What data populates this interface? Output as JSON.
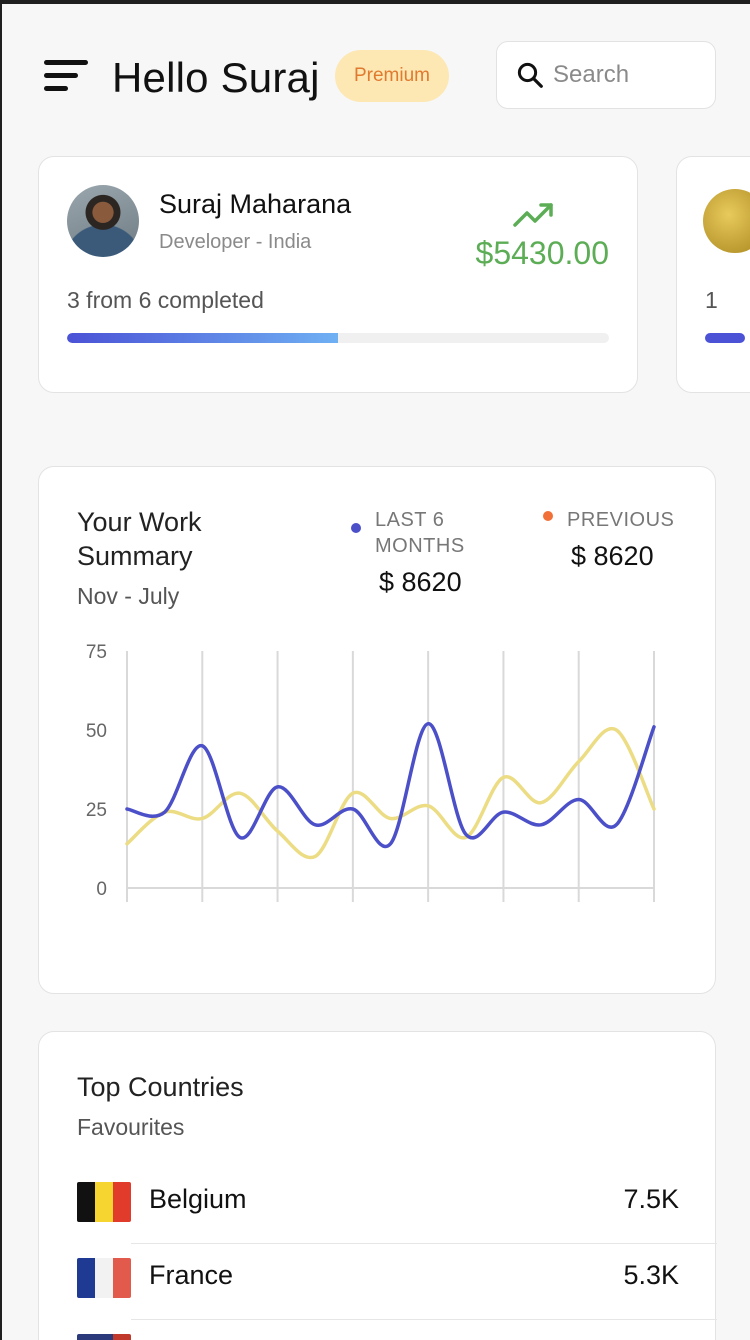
{
  "header": {
    "greeting": "Hello Suraj",
    "badge": "Premium",
    "search_placeholder": "Search"
  },
  "profile": {
    "name": "Suraj Maharana",
    "role": "Developer - India",
    "earnings": "$5430.00",
    "progress_text": "3 from 6 completed",
    "progress_fraction": 0.5,
    "earnings_color": "#5cad55"
  },
  "profile_peek": {
    "progress_text": "1"
  },
  "summary": {
    "title": "Your Work Summary",
    "range": "Nov - July",
    "legend": [
      {
        "label": "LAST 6 MONTHS",
        "value": "$ 8620",
        "color": "#4b4fc8"
      },
      {
        "label": "PREVIOUS",
        "value": "$ 8620",
        "color": "#f07038"
      }
    ]
  },
  "chart_data": {
    "type": "line",
    "y_ticks": [
      "75",
      "50",
      "25",
      "0"
    ],
    "ylim": [
      0,
      75
    ],
    "x": [
      0,
      0.5,
      1,
      1.5,
      2,
      2.5,
      3,
      3.5,
      4,
      4.5,
      5,
      5.5,
      6,
      6.5,
      7
    ],
    "grid": "vertical",
    "series": [
      {
        "color": "#4b4fc8",
        "values": [
          25,
          24,
          45,
          16,
          32,
          20,
          25,
          14,
          52,
          17,
          24,
          20,
          28,
          20,
          51
        ]
      },
      {
        "color": "#ecdc84",
        "values": [
          14,
          24,
          22,
          30,
          18,
          10,
          30,
          22,
          26,
          16,
          35,
          27,
          40,
          50,
          25
        ]
      }
    ]
  },
  "countries": {
    "title": "Top Countries",
    "subtitle": "Favourites",
    "items": [
      {
        "name": "Belgium",
        "value": "7.5K",
        "flag": [
          "#111111",
          "#f7d531",
          "#e03b2b"
        ]
      },
      {
        "name": "France",
        "value": "5.3K",
        "flag": [
          "#1f3a93",
          "#f2f2f2",
          "#e25a4b"
        ]
      },
      {
        "name": "",
        "value": "",
        "flag": [
          "#2b3a7a",
          "#2b3a7a",
          "#c0392b"
        ]
      }
    ]
  }
}
